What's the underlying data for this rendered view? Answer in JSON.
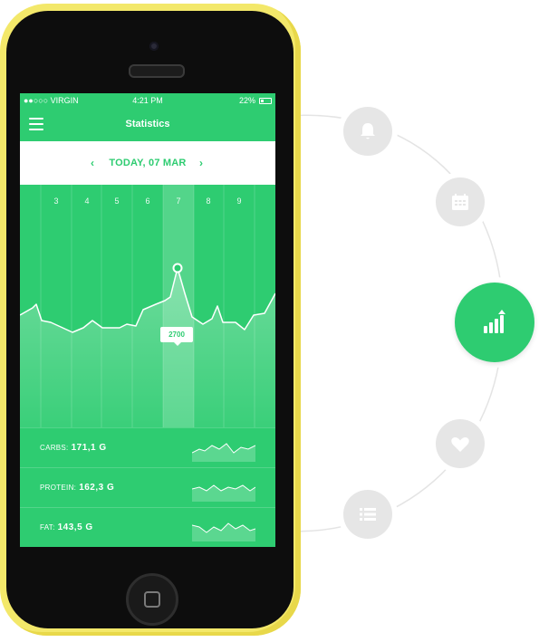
{
  "status_bar": {
    "carrier": "●●○○○ VIRGIN",
    "time": "4:21 PM",
    "battery_percent": "22%"
  },
  "header": {
    "title": "Statistics"
  },
  "date_selector": {
    "label": "TODAY, 07 MAR",
    "prev": "‹",
    "next": "›"
  },
  "chart": {
    "days": [
      "3",
      "4",
      "5",
      "6",
      "7",
      "8",
      "9"
    ],
    "selected_day": "7",
    "selected_value": "2700"
  },
  "stats": [
    {
      "label": "CARBS:",
      "value": "171,1 G"
    },
    {
      "label": "PROTEIN:",
      "value": "162,3 G"
    },
    {
      "label": "FAT:",
      "value": "143,5 G"
    }
  ],
  "side_nav": [
    {
      "icon": "bell-icon"
    },
    {
      "icon": "calendar-icon"
    },
    {
      "icon": "statistics-icon",
      "active": true
    },
    {
      "icon": "heart-icon"
    },
    {
      "icon": "list-icon"
    }
  ],
  "colors": {
    "accent": "#2ecc71",
    "phone_body": "#f3e86a",
    "inactive_circle": "#e6e6e6"
  }
}
